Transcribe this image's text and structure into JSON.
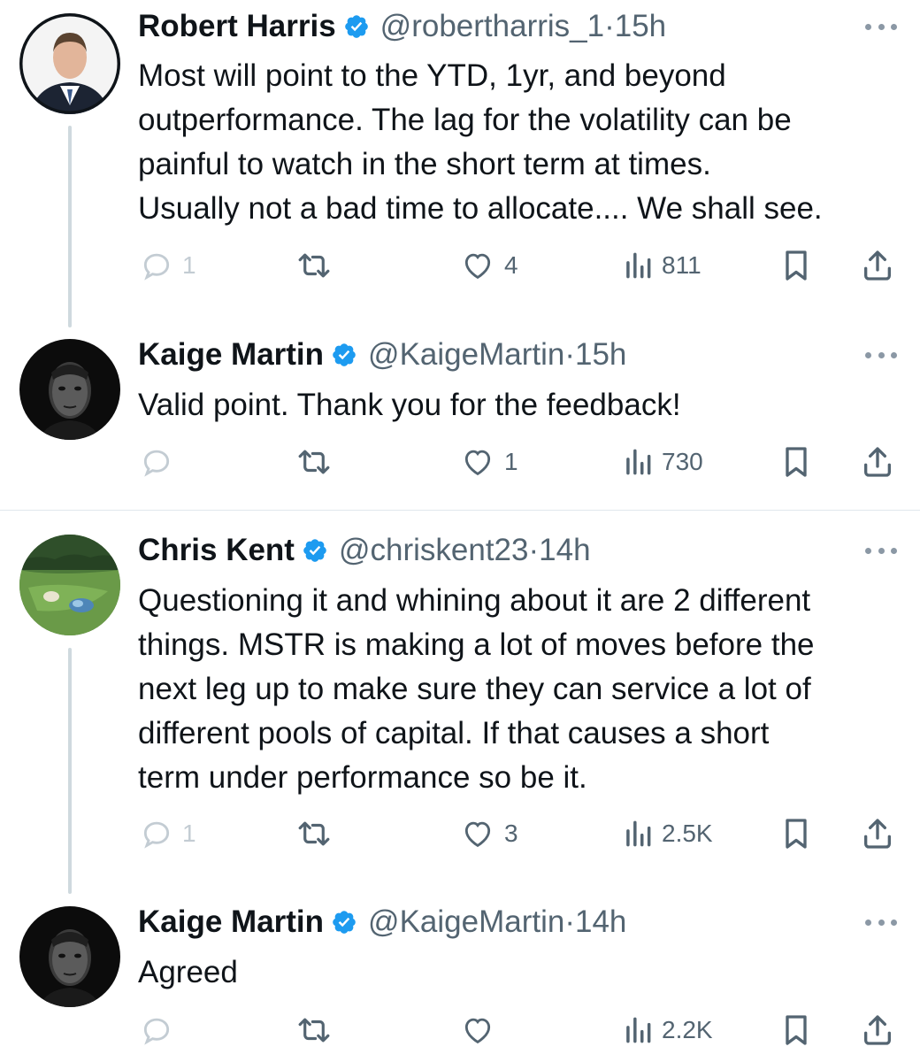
{
  "tweets": [
    {
      "name": "Robert Harris",
      "handle": "@robertharris_1",
      "separator": "·",
      "time": "15h",
      "text_lines": [
        "Most will point to the YTD, 1yr, and beyond",
        "outperformance. The lag for the volatility can be",
        "painful to watch in the short term at times.",
        "Usually not a bad time to allocate.... We shall see."
      ],
      "replies": "1",
      "likes": "4",
      "views": "811"
    },
    {
      "name": "Kaige Martin",
      "handle": "@KaigeMartin",
      "separator": "·",
      "time": "15h",
      "text_lines": [
        "Valid point. Thank you for the feedback!"
      ],
      "replies": "",
      "likes": "1",
      "views": "730"
    },
    {
      "name": "Chris Kent",
      "handle": "@chriskent23",
      "separator": "·",
      "time": "14h",
      "text_lines": [
        "Questioning it and whining about it are 2 different",
        "things. MSTR is making a lot of moves before the",
        "next leg up to make sure they can service a lot of",
        "different pools of capital. If that causes a short",
        "term under performance so be it."
      ],
      "replies": "1",
      "likes": "3",
      "views": "2.5K"
    },
    {
      "name": "Kaige Martin",
      "handle": "@KaigeMartin",
      "separator": "·",
      "time": "14h",
      "text_lines": [
        "Agreed"
      ],
      "replies": "",
      "likes": "",
      "views": "2.2K"
    }
  ],
  "icons": {
    "verified": "verified-badge-icon",
    "more": "more-options-icon",
    "reply": "reply-icon",
    "retweet": "retweet-icon",
    "like": "like-icon",
    "views": "views-icon",
    "bookmark": "bookmark-icon",
    "share": "share-icon"
  },
  "colors": {
    "verified": "#1d9bf0",
    "text": "#0f1419",
    "secondary": "#536471",
    "thread_line": "#cfd9de",
    "divider": "#e1e8ed"
  }
}
